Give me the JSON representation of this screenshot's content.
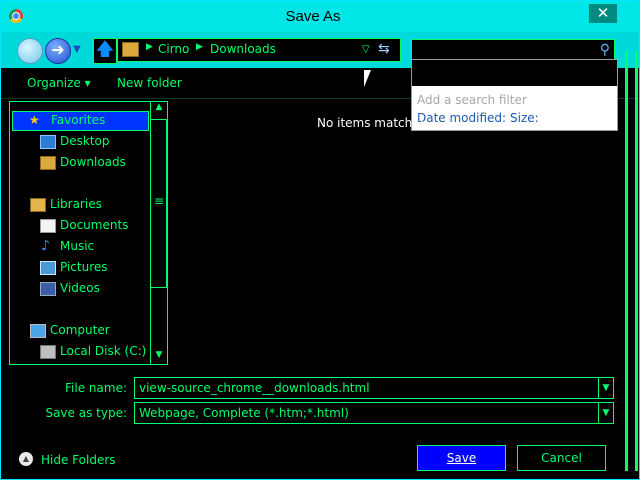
{
  "window": {
    "title": "Save As",
    "close_label": "✕"
  },
  "nav": {
    "breadcrumbs": [
      "Cirno",
      "Downloads"
    ],
    "search_placeholder": ""
  },
  "toolbar": {
    "organize_label": "Organize ▾",
    "new_folder_label": "New folder"
  },
  "filter_popup": {
    "hint": "Add a search filter",
    "date_modified": "Date modified:",
    "size": "Size:"
  },
  "sidebar": {
    "favorites_label": "Favorites",
    "favorites": [
      "Desktop",
      "Downloads"
    ],
    "libraries_label": "Libraries",
    "libraries": [
      "Documents",
      "Music",
      "Pictures",
      "Videos"
    ],
    "computer_label": "Computer",
    "drives": [
      "Local Disk (C:)"
    ]
  },
  "content": {
    "empty_message": "No items match y"
  },
  "form": {
    "file_name_label": "File name:",
    "file_name_value": "view-source_chrome__downloads.html",
    "save_type_label": "Save as type:",
    "save_type_value": "Webpage, Complete (*.htm;*.html)"
  },
  "footer": {
    "hide_folders_label": "Hide Folders",
    "save_label": "Save",
    "cancel_label": "Cancel"
  },
  "colors": {
    "accent": "#00ff6a",
    "titlebar": "#00e6e6",
    "selection": "#0033ff",
    "background": "#000000"
  }
}
